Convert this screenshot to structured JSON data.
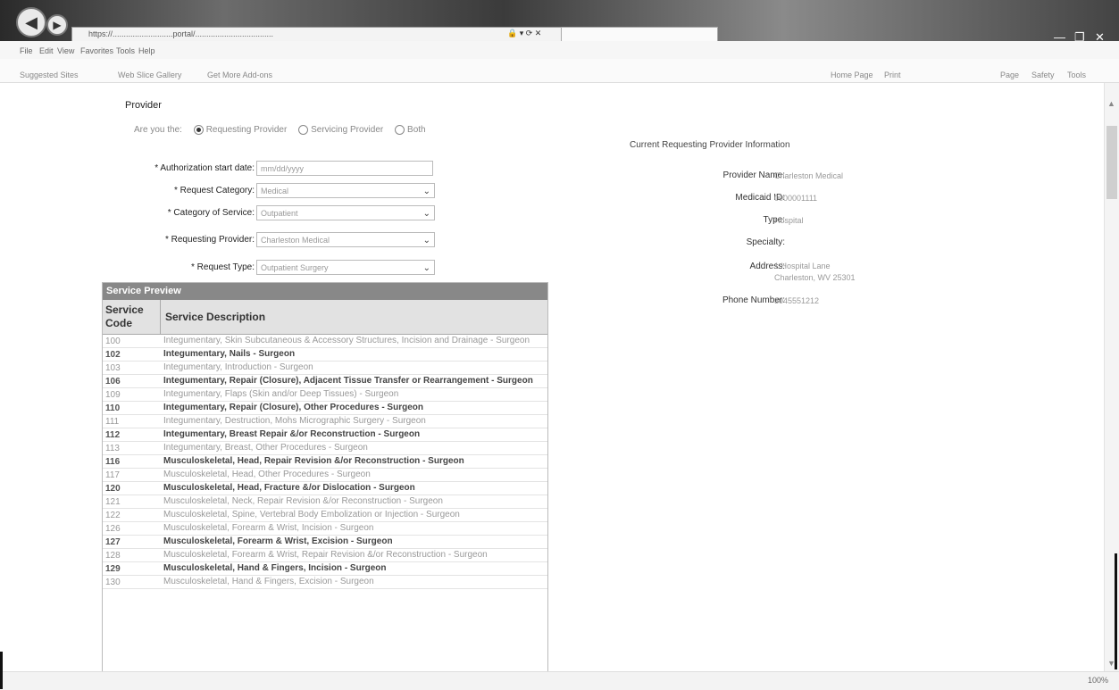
{
  "browser": {
    "address_url": "https://...........................portal/...................................",
    "address_controls": "🔒 ▾ ⟳ ✕",
    "tab_title": "",
    "window_controls": [
      "—",
      "❐",
      "✕"
    ],
    "menu": [
      "File",
      "Edit",
      "View",
      "Favorites",
      "Tools",
      "Help"
    ],
    "favorites": [
      "Suggested Sites",
      "Web Slice Gallery",
      "Get More Add-ons",
      "Home Page",
      "Print",
      "Page",
      "Safety",
      "Tools"
    ],
    "zoom": "100%"
  },
  "provider_section": {
    "heading": "Provider",
    "radio_prompt": "Are you the:",
    "radio_options": [
      {
        "label": "Requesting Provider",
        "selected": true
      },
      {
        "label": "Servicing Provider",
        "selected": false
      },
      {
        "label": "Both",
        "selected": false
      }
    ]
  },
  "form": {
    "start_date": {
      "label": "* Authorization start date:",
      "value": "mm/dd/yyyy"
    },
    "request_category": {
      "label": "* Request Category:",
      "value": "Medical"
    },
    "category_of_service": {
      "label": "* Category of Service:",
      "value": "Outpatient"
    },
    "requesting_provider": {
      "label": "* Requesting Provider:",
      "value": "Charleston Medical"
    },
    "request_type": {
      "label": "* Request Type:",
      "value": "Outpatient Surgery"
    }
  },
  "service_preview": {
    "title": "Service Preview",
    "col_code": "Service Code",
    "col_desc": "Service Description",
    "rows": [
      {
        "code": "100",
        "desc": "Integumentary, Skin Subcutaneous & Accessory Structures, Incision and Drainage - Surgeon",
        "dark": false
      },
      {
        "code": "102",
        "desc": "Integumentary, Nails - Surgeon",
        "dark": true
      },
      {
        "code": "103",
        "desc": "Integumentary, Introduction - Surgeon",
        "dark": false
      },
      {
        "code": "106",
        "desc": "Integumentary, Repair (Closure), Adjacent Tissue Transfer or Rearrangement - Surgeon",
        "dark": true
      },
      {
        "code": "109",
        "desc": "Integumentary, Flaps (Skin and/or Deep Tissues) - Surgeon",
        "dark": false
      },
      {
        "code": "110",
        "desc": "Integumentary, Repair (Closure), Other Procedures - Surgeon",
        "dark": true
      },
      {
        "code": "111",
        "desc": "Integumentary, Destruction, Mohs Micrographic Surgery - Surgeon",
        "dark": false
      },
      {
        "code": "112",
        "desc": "Integumentary, Breast Repair &/or Reconstruction - Surgeon",
        "dark": true
      },
      {
        "code": "113",
        "desc": "Integumentary, Breast, Other Procedures - Surgeon",
        "dark": false
      },
      {
        "code": "116",
        "desc": "Musculoskeletal, Head, Repair Revision &/or Reconstruction - Surgeon",
        "dark": true
      },
      {
        "code": "117",
        "desc": "Musculoskeletal, Head, Other Procedures - Surgeon",
        "dark": false
      },
      {
        "code": "120",
        "desc": "Musculoskeletal, Head, Fracture &/or Dislocation - Surgeon",
        "dark": true
      },
      {
        "code": "121",
        "desc": "Musculoskeletal, Neck, Repair Revision &/or Reconstruction - Surgeon",
        "dark": false
      },
      {
        "code": "122",
        "desc": "Musculoskeletal, Spine, Vertebral Body Embolization or Injection - Surgeon",
        "dark": false
      },
      {
        "code": "126",
        "desc": "Musculoskeletal, Forearm & Wrist, Incision - Surgeon",
        "dark": false
      },
      {
        "code": "127",
        "desc": "Musculoskeletal, Forearm & Wrist, Excision - Surgeon",
        "dark": true
      },
      {
        "code": "128",
        "desc": "Musculoskeletal, Forearm & Wrist, Repair Revision &/or Reconstruction - Surgeon",
        "dark": false
      },
      {
        "code": "129",
        "desc": "Musculoskeletal, Hand & Fingers, Incision - Surgeon",
        "dark": true
      },
      {
        "code": "130",
        "desc": "Musculoskeletal, Hand & Fingers, Excision - Surgeon",
        "dark": false
      }
    ]
  },
  "current_provider": {
    "heading": "Current Requesting Provider Information",
    "provider_name": {
      "label": "Provider Name:",
      "value": "Charleston Medical"
    },
    "medicaid_id": {
      "label": "Medicaid ID:",
      "value": "0000001111"
    },
    "type": {
      "label": "Type:",
      "value": "Hospital"
    },
    "specialty": {
      "label": "Specialty:",
      "value": ""
    },
    "address": {
      "label": "Address:",
      "line1": "1 Hospital Lane",
      "line2": "Charleston, WV 25301"
    },
    "phone": {
      "label": "Phone Number:",
      "value": "3045551212"
    }
  }
}
